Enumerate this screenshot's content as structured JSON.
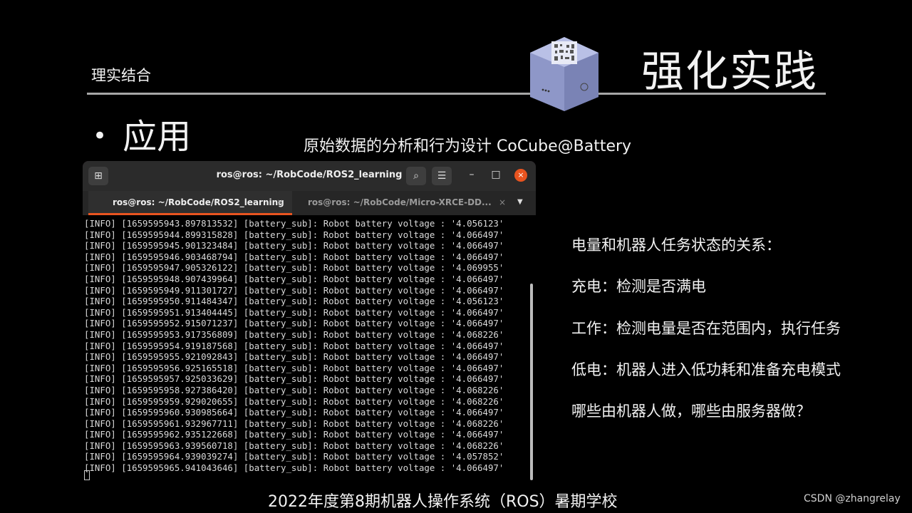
{
  "slide": {
    "subtitle": "理实结合",
    "title": "强化实践",
    "bullet": "应用",
    "caption": "原始数据的分析和行为设计 CoCube@Battery",
    "footer": "2022年度第8期机器人操作系统（ROS）暑期学校",
    "watermark": "CSDN @zhangrelay"
  },
  "terminal": {
    "title": "ros@ros: ~/RobCode/ROS2_learning",
    "tabs": [
      {
        "label": "ros@ros: ~/RobCode/ROS2_learning",
        "close": "×"
      },
      {
        "label": "ros@ros: ~/RobCode/Micro-XRCE-DD...",
        "close": "×"
      }
    ],
    "search_icon": "⌕",
    "menu_icon": "☰",
    "new_tab_icon": "⊞",
    "minimize": "–",
    "maximize": "□",
    "close": "×",
    "dropdown": "▼",
    "log_lines": [
      "[INFO] [1659595943.897813532] [battery_sub]: Robot battery voltage : '4.056123'",
      "[INFO] [1659595944.899315828] [battery_sub]: Robot battery voltage : '4.066497'",
      "[INFO] [1659595945.901323484] [battery_sub]: Robot battery voltage : '4.066497'",
      "[INFO] [1659595946.903468794] [battery_sub]: Robot battery voltage : '4.066497'",
      "[INFO] [1659595947.905326122] [battery_sub]: Robot battery voltage : '4.069955'",
      "[INFO] [1659595948.907439964] [battery_sub]: Robot battery voltage : '4.066497'",
      "[INFO] [1659595949.911301727] [battery_sub]: Robot battery voltage : '4.066497'",
      "[INFO] [1659595950.911484347] [battery_sub]: Robot battery voltage : '4.056123'",
      "[INFO] [1659595951.913404445] [battery_sub]: Robot battery voltage : '4.066497'",
      "[INFO] [1659595952.915071237] [battery_sub]: Robot battery voltage : '4.066497'",
      "[INFO] [1659595953.917356809] [battery_sub]: Robot battery voltage : '4.068226'",
      "[INFO] [1659595954.919187568] [battery_sub]: Robot battery voltage : '4.066497'",
      "[INFO] [1659595955.921092843] [battery_sub]: Robot battery voltage : '4.066497'",
      "[INFO] [1659595956.925165518] [battery_sub]: Robot battery voltage : '4.066497'",
      "[INFO] [1659595957.925033629] [battery_sub]: Robot battery voltage : '4.066497'",
      "[INFO] [1659595958.927386420] [battery_sub]: Robot battery voltage : '4.068226'",
      "[INFO] [1659595959.929020655] [battery_sub]: Robot battery voltage : '4.068226'",
      "[INFO] [1659595960.930985664] [battery_sub]: Robot battery voltage : '4.066497'",
      "[INFO] [1659595961.932967711] [battery_sub]: Robot battery voltage : '4.068226'",
      "[INFO] [1659595962.935122668] [battery_sub]: Robot battery voltage : '4.066497'",
      "[INFO] [1659595963.939560718] [battery_sub]: Robot battery voltage : '4.068226'",
      "[INFO] [1659595964.939039274] [battery_sub]: Robot battery voltage : '4.057852'",
      "[INFO] [1659595965.941043646] [battery_sub]: Robot battery voltage : '4.066497'"
    ]
  },
  "notes": [
    "电量和机器人任务状态的关系：",
    "充电：检测是否满电",
    "工作：检测电量是否在范围内，执行任务",
    "低电：机器人进入低功耗和准备充电模式",
    "哪些由机器人做，哪些由服务器做？"
  ],
  "colors": {
    "background": "#000000",
    "rule": "#a6a6a6",
    "tab_accent": "#e95420",
    "close_button": "#e9541f"
  }
}
